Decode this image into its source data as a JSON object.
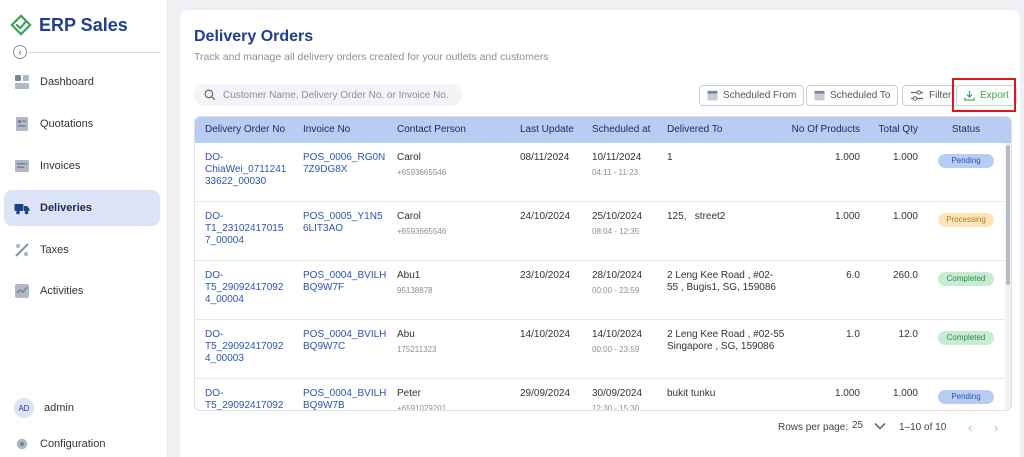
{
  "app": {
    "name": "ERP Sales"
  },
  "sidebar": {
    "items": [
      {
        "label": "Dashboard",
        "icon": "dashboard-icon"
      },
      {
        "label": "Quotations",
        "icon": "quotations-icon"
      },
      {
        "label": "Invoices",
        "icon": "invoices-icon"
      },
      {
        "label": "Deliveries",
        "icon": "truck-icon",
        "active": true
      },
      {
        "label": "Taxes",
        "icon": "taxes-icon"
      },
      {
        "label": "Activities",
        "icon": "activities-icon"
      }
    ],
    "user": {
      "initials": "AD",
      "name": "admin"
    },
    "configuration": {
      "label": "Configuration"
    }
  },
  "page": {
    "title": "Delivery Orders",
    "subtitle": "Track and manage all delivery orders created for your outlets and customers"
  },
  "toolbar": {
    "search_placeholder": "Customer Name, Delivery Order No. or Invoice No.",
    "scheduled_from": "Scheduled From",
    "scheduled_to": "Scheduled To",
    "filter": "Filter",
    "export": "Export"
  },
  "table": {
    "columns": [
      "Delivery Order No",
      "Invoice No",
      "Contact Person",
      "Last Update",
      "Scheduled at",
      "Delivered To",
      "No Of Products",
      "Total Qty",
      "Status"
    ],
    "rows": [
      {
        "do_lines": [
          "DO-",
          "ChiaWei_0711241",
          "33622_00030"
        ],
        "inv_lines": [
          "POS_0006_RG0N",
          "7Z9DG8X"
        ],
        "contact": "Carol",
        "phone": "+6593665546",
        "last_update": "08/11/2024",
        "sched_date": "10/11/2024",
        "sched_time": "04:11 - 11:23",
        "delivered_lines": [
          "1"
        ],
        "products": "1.000",
        "qty": "1.000",
        "status": "Pending",
        "status_type": "pending"
      },
      {
        "do_lines": [
          "DO-",
          "T1_23102417015",
          "7_00004"
        ],
        "inv_lines": [
          "POS_0005_Y1N5",
          "6LIT3AO"
        ],
        "contact": "Carol",
        "phone": "+6593665546",
        "last_update": "24/10/2024",
        "sched_date": "25/10/2024",
        "sched_time": "08:04 - 12:35",
        "delivered_lines": [
          "125,   street2"
        ],
        "products": "1.000",
        "qty": "1.000",
        "status": "Processing",
        "status_type": "processing"
      },
      {
        "do_lines": [
          "DO-",
          "T5_29092417092",
          "4_00004"
        ],
        "inv_lines": [
          "POS_0004_BVILH",
          "BQ9W7F"
        ],
        "contact": "Abu1",
        "phone": "95138878",
        "last_update": "23/10/2024",
        "sched_date": "28/10/2024",
        "sched_time": "00:00 - 23:59",
        "delivered_lines": [
          "2 Leng Kee Road , #02-",
          "55 , Bugis1, SG, 159086"
        ],
        "products": "6.0",
        "qty": "260.0",
        "status": "Completed",
        "status_type": "completed"
      },
      {
        "do_lines": [
          "DO-",
          "T5_29092417092",
          "4_00003"
        ],
        "inv_lines": [
          "POS_0004_BVILH",
          "BQ9W7C"
        ],
        "contact": "Abu",
        "phone": "175211323",
        "last_update": "14/10/2024",
        "sched_date": "14/10/2024",
        "sched_time": "00:00 - 23:59",
        "delivered_lines": [
          "2 Leng Kee Road , #02-55",
          "Singapore , SG, 159086"
        ],
        "products": "1.0",
        "qty": "12.0",
        "status": "Completed",
        "status_type": "completed"
      },
      {
        "do_lines": [
          "DO-",
          "T5_29092417092",
          "4_00002"
        ],
        "inv_lines": [
          "POS_0004_BVILH",
          "BQ9W7B"
        ],
        "contact": "Peter",
        "phone": "+6591029201",
        "last_update": "29/09/2024",
        "sched_date": "30/09/2024",
        "sched_time": "12:30 - 15:30",
        "delivered_lines": [
          "bukit tunku"
        ],
        "products": "1.000",
        "qty": "1.000",
        "status": "Pending",
        "status_type": "pending"
      }
    ]
  },
  "pagination": {
    "rows_per_page_label": "Rows per page:",
    "rows_per_page": "25",
    "range": "1–10 of 10"
  },
  "colors": {
    "brand": "#1f3f8f",
    "accent_green": "#3aa655",
    "header_bg": "#b9cdf4",
    "pending": "#b9cdf4",
    "processing": "#fde6b8",
    "completed": "#c8ecd3",
    "highlight": "#e0161e"
  }
}
